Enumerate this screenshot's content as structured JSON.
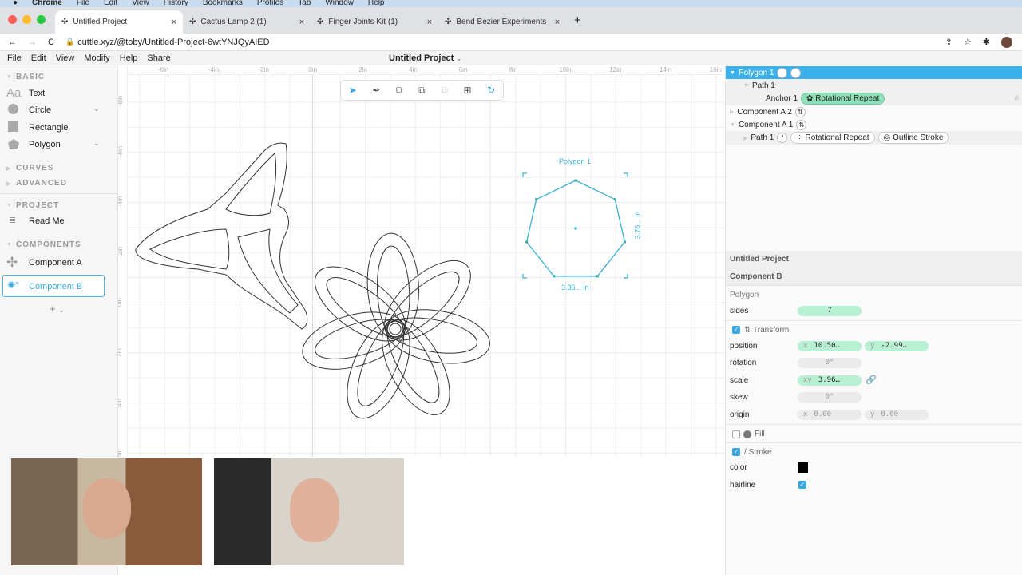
{
  "os_menu": [
    "Chrome",
    "File",
    "Edit",
    "View",
    "History",
    "Bookmarks",
    "Profiles",
    "Tab",
    "Window",
    "Help"
  ],
  "tabs": [
    {
      "label": "Untitled Project",
      "active": true
    },
    {
      "label": "Cactus Lamp 2 (1)"
    },
    {
      "label": "Finger Joints Kit (1)"
    },
    {
      "label": "Bend Bezier Experiments"
    }
  ],
  "address": {
    "url": "cuttle.xyz/@toby/Untitled-Project-6wtYNJQyAIED"
  },
  "app_menu": [
    "File",
    "Edit",
    "View",
    "Modify",
    "Help",
    "Share"
  ],
  "project_title": "Untitled Project",
  "sidebar": {
    "basic": "BASIC",
    "basic_items": [
      "Text",
      "Circle",
      "Rectangle",
      "Polygon"
    ],
    "curves": "CURVES",
    "advanced": "ADVANCED",
    "project": "PROJECT",
    "project_items": [
      "Read Me"
    ],
    "components": "COMPONENTS",
    "component_items": [
      "Component A",
      "Component B"
    ],
    "add": "+"
  },
  "ruler": {
    "x": [
      "-6in",
      "-4in",
      "-2in",
      "0in",
      "2in",
      "4in",
      "6in",
      "8in",
      "10in",
      "12in",
      "14in",
      "16in"
    ],
    "y": [
      "-8in",
      "-6in",
      "-4in",
      "-2in",
      "0in",
      "2in",
      "4in",
      "6in"
    ]
  },
  "canvas": {
    "selection_label": "Polygon 1",
    "width_label": "3.86... in",
    "height_label": "3.76... in",
    "accent": "#3bb0d6"
  },
  "tree": {
    "polygon": "Polygon 1",
    "path1": "Path 1",
    "anchor": "Anchor 1",
    "rot_repeat": "Rotational Repeat",
    "comp_a2": "Component A 2",
    "comp_a1": "Component A 1",
    "path1b": "Path 1",
    "rot_repeat2": "Rotational Repeat",
    "outline_stroke": "Outline Stroke",
    "grid": "#"
  },
  "inspector": {
    "project": "Untitled Project",
    "component": "Component B",
    "shape": "Polygon",
    "sides_label": "sides",
    "sides": "7",
    "transform": "Transform",
    "position_label": "position",
    "pos_x": "10.50…",
    "pos_y": "-2.99…",
    "rotation_label": "rotation",
    "rotation": "0°",
    "scale_label": "scale",
    "scale": "3.96…",
    "skew_label": "skew",
    "skew": "0°",
    "origin_label": "origin",
    "origin_x": "0.00",
    "origin_y": "0.00",
    "fill": "Fill",
    "fill_on": false,
    "stroke": "Stroke",
    "stroke_on": true,
    "color_label": "color",
    "color": "#000000",
    "hairline_label": "hairline",
    "hairline": true,
    "x": "x",
    "y": "y",
    "xy": "xy"
  }
}
